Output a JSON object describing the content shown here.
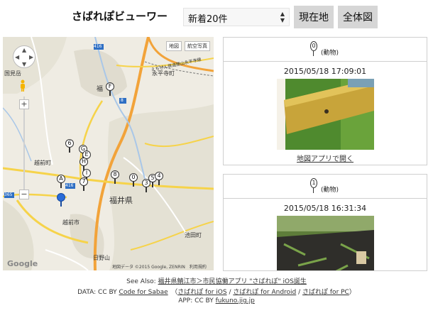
{
  "header": {
    "title": "さばれぽビューワー",
    "filter_selected": "新着20件",
    "btn_current": "現在地",
    "btn_all": "全体図"
  },
  "map": {
    "maptype_map": "地図",
    "maptype_aerial": "航空写真",
    "prefecture": "福井県",
    "google": "Google",
    "attribution": "地図データ ©2015 Google, ZENRIN　利用規約",
    "labels": {
      "kokuteki": "国見岳",
      "fuku": "福",
      "eiheiji": "永平寺町",
      "echizen_tetsudo": "えちぜん鉄道勝山永平寺線",
      "echizencho": "越前町",
      "echizenshi": "越前市",
      "hinoyama": "日野山",
      "ikeda": "池田町",
      "r416": "416",
      "r365": "365",
      "r8": "8"
    },
    "markers": [
      "F",
      "6",
      "G",
      "E",
      "H",
      "I",
      "7",
      "A",
      "8",
      "0",
      "5",
      "4",
      "3"
    ],
    "zoom_in": "+",
    "zoom_out": "−"
  },
  "reports": [
    {
      "index": "0",
      "category": "(動物)",
      "date": "2015/05/18 17:09:01",
      "link": "地図アプリで開く"
    },
    {
      "index": "1",
      "category": "(動物)",
      "date": "2015/05/18 16:31:34"
    }
  ],
  "footer": {
    "see_also_label": "See Also: ",
    "see_also_link": "福井県鯖江市＞市民協働アプリ \"さばれぽ\" iOS誕生",
    "data_label": "DATA: CC BY ",
    "data_link": "Code for Sabae",
    "paren_open": "　（",
    "ios": "さばれぽ for iOS",
    "sep1": " / ",
    "android": "さばれぽ for Android",
    "sep2": " / ",
    "pc": "さばれぽ for PC",
    "paren_close": "）",
    "app_label": "APP: CC BY ",
    "app_link": "fukuno.jig.jp"
  }
}
